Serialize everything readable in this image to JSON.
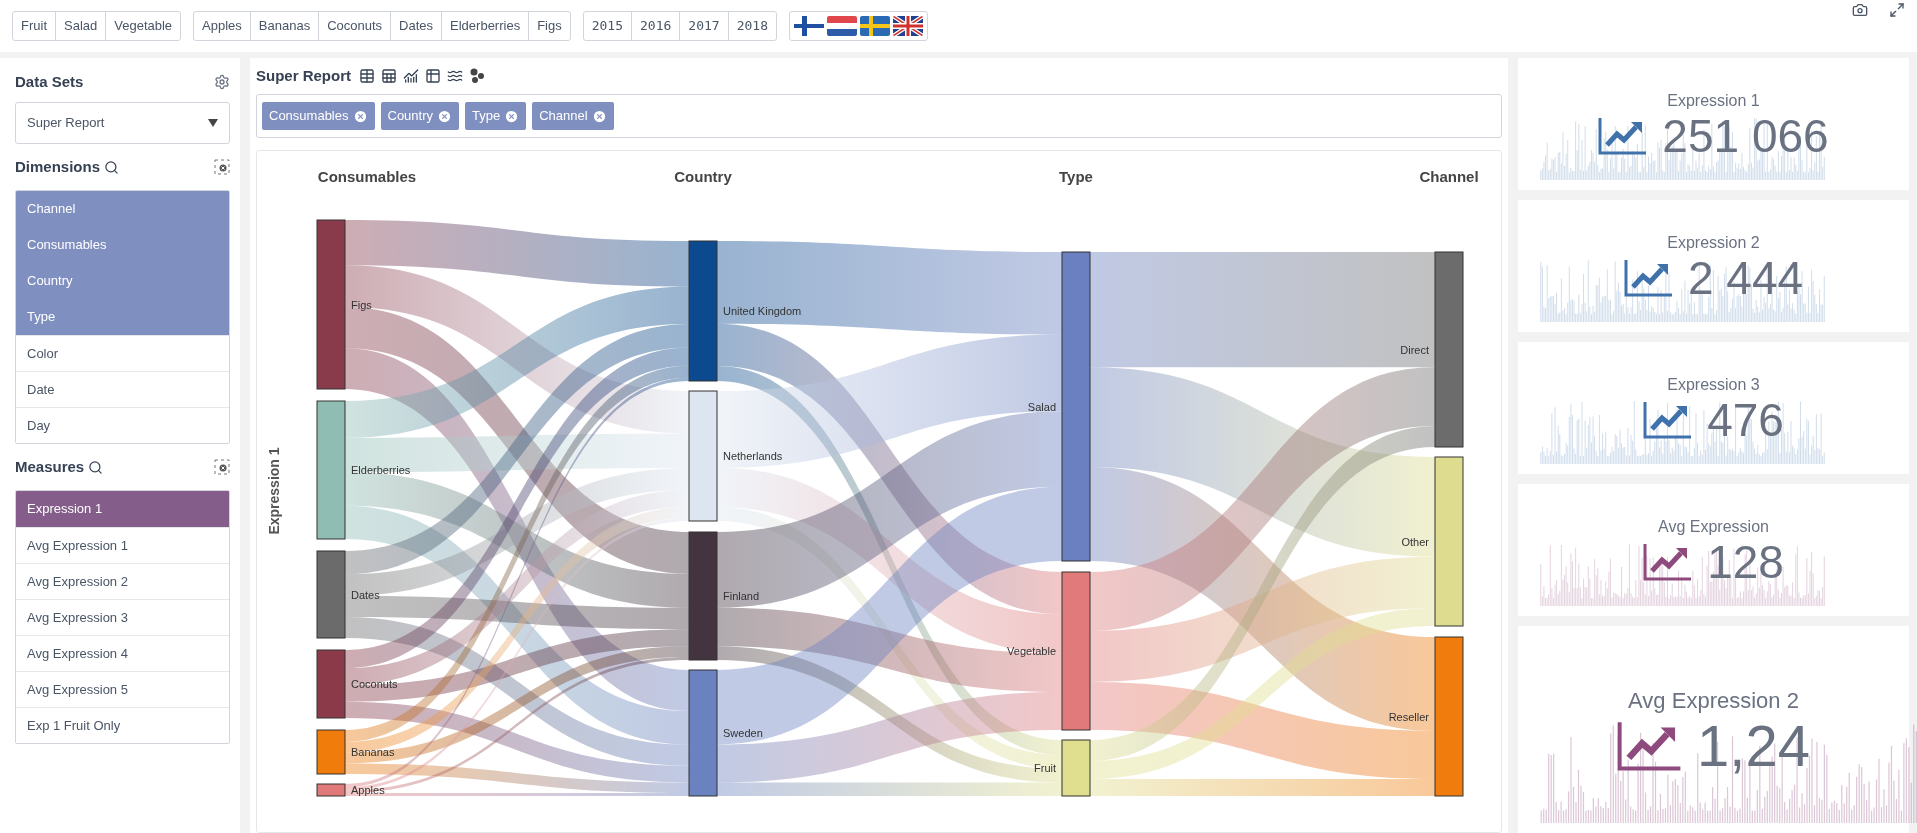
{
  "top_filters": {
    "types": [
      "Fruit",
      "Salad",
      "Vegetable"
    ],
    "consumables": [
      "Apples",
      "Bananas",
      "Coconuts",
      "Dates",
      "Elderberries",
      "Figs"
    ],
    "years": [
      "2015",
      "2016",
      "2017",
      "2018"
    ]
  },
  "sidebar": {
    "data_sets": {
      "title": "Data Sets",
      "dropdown": "Super Report"
    },
    "dimensions": {
      "title": "Dimensions",
      "items": [
        {
          "label": "Channel",
          "selected": true
        },
        {
          "label": "Consumables",
          "selected": true
        },
        {
          "label": "Country",
          "selected": true
        },
        {
          "label": "Type",
          "selected": true
        },
        {
          "label": "Color",
          "selected": false
        },
        {
          "label": "Date",
          "selected": false
        },
        {
          "label": "Day",
          "selected": false
        }
      ]
    },
    "measures": {
      "title": "Measures",
      "items": [
        {
          "label": "Expression 1",
          "selected": true
        },
        {
          "label": "Avg Expression 1",
          "selected": false
        },
        {
          "label": "Avg Expression 2",
          "selected": false
        },
        {
          "label": "Avg Expression 3",
          "selected": false
        },
        {
          "label": "Avg Expression 4",
          "selected": false
        },
        {
          "label": "Avg Expression 5",
          "selected": false
        },
        {
          "label": "Exp 1 Fruit Only",
          "selected": false
        }
      ]
    }
  },
  "report": {
    "title": "Super Report",
    "chips": [
      "Consumables",
      "Country",
      "Type",
      "Channel"
    ],
    "sankey": {
      "y_label": "Expression 1",
      "columns": [
        {
          "title": "Consumables",
          "nodes": [
            {
              "label": "Figs",
              "color": "#8a3b4b"
            },
            {
              "label": "Elderberries",
              "color": "#8fbcb3"
            },
            {
              "label": "Dates",
              "color": "#6b6b6b"
            },
            {
              "label": "Coconuts",
              "color": "#8a3a48"
            },
            {
              "label": "Bananas",
              "color": "#f07c0c"
            },
            {
              "label": "Apples",
              "color": "#e07a7a"
            }
          ]
        },
        {
          "title": "Country",
          "nodes": [
            {
              "label": "United Kingdom",
              "color": "#0b4a8f"
            },
            {
              "label": "Netherlands",
              "color": "#dde5f0"
            },
            {
              "label": "Finland",
              "color": "#43343f"
            },
            {
              "label": "Sweden",
              "color": "#6a82c0"
            }
          ]
        },
        {
          "title": "Type",
          "nodes": [
            {
              "label": "Salad",
              "color": "#6a80c0"
            },
            {
              "label": "Vegetable",
              "color": "#e07a7b"
            },
            {
              "label": "Fruit",
              "color": "#dfdf8f"
            }
          ]
        },
        {
          "title": "Channel",
          "nodes": [
            {
              "label": "Direct",
              "color": "#6c6c6c"
            },
            {
              "label": "Other",
              "color": "#dedd8f"
            },
            {
              "label": "Reseller",
              "color": "#f07c0d"
            }
          ]
        }
      ]
    }
  },
  "kpis": [
    {
      "label": "Expression 1",
      "value": "251 066",
      "color": "#3f72aa"
    },
    {
      "label": "Expression 2",
      "value": "2 444",
      "color": "#3f72ab"
    },
    {
      "label": "Expression 3",
      "value": "476",
      "color": "#3f72ac"
    },
    {
      "label": "Avg Expression",
      "value": "128",
      "color": "#8e4a7c"
    },
    {
      "label": "Avg Expression 2",
      "value": "1,24",
      "color": "#8e4a7d"
    }
  ]
}
